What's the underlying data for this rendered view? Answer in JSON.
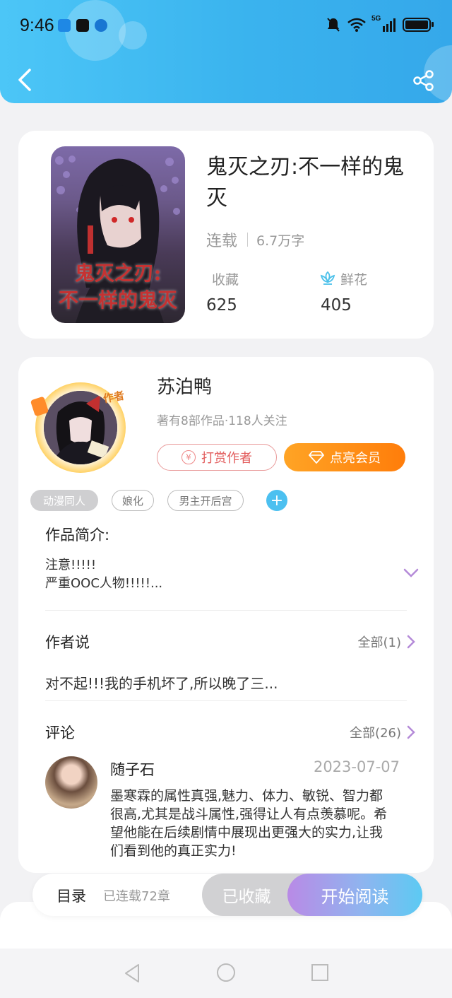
{
  "status_bar": {
    "time": "9:46",
    "network": "5G"
  },
  "book": {
    "cover_text_line1": "鬼灭之刃:",
    "cover_text_line2": "不一样的鬼灭",
    "title": "鬼灭之刃:不一样的鬼灭",
    "status": "连载",
    "word_count": "6.7万字",
    "favorites_label": "收藏",
    "favorites_value": "625",
    "flowers_label": "鲜花",
    "flowers_value": "405"
  },
  "author": {
    "badge": "作者",
    "name": "苏泊鸭",
    "meta": "著有8部作品·118人关注",
    "tip_label": "打赏作者",
    "vip_label": "点亮会员"
  },
  "tags": [
    "动漫同人",
    "娘化",
    "男主开后宫"
  ],
  "intro": {
    "title": "作品简介:",
    "line1": "注意!!!!!",
    "line2": "严重OOC人物!!!!!..."
  },
  "author_says": {
    "title": "作者说",
    "more_label": "全部(1)",
    "text": "对不起!!!我的手机坏了,所以晚了三..."
  },
  "comments": {
    "title": "评论",
    "more_label": "全部(26)",
    "items": [
      {
        "user": "随子石",
        "date": "2023-07-07",
        "text": "墨寒霖的属性真强,魅力、体力、敏锐、智力都很高,尤其是战斗属性,强得让人有点羡慕呢。希望他能在后续剧情中展现出更强大的实力,让我们看到他的真正实力!"
      }
    ]
  },
  "action_bar": {
    "toc_label": "目录",
    "chapter_count": "已连载72章",
    "collected_label": "已收藏",
    "read_label": "开始阅读"
  },
  "colors": {
    "header_start": "#4cc6f7",
    "header_end": "#35a8ea",
    "vip_orange": "#ff8a12",
    "tip_red": "#e25c5c",
    "read_gradient_start": "#b98ae6",
    "read_gradient_end": "#5ccaf3",
    "accent_purple": "#b48ad8"
  },
  "icons": {
    "back": "chevron-left-icon",
    "share": "share-icon",
    "flower": "lotus-icon",
    "expand": "chevron-down-icon",
    "more": "chevron-right-icon",
    "add_tag": "plus-icon",
    "tip": "yen-coin-icon",
    "vip": "diamond-icon"
  }
}
